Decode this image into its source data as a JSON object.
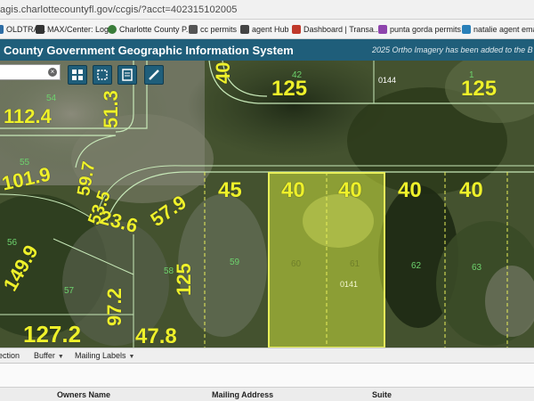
{
  "browser": {
    "url": "agis.charlottecountyfl.gov/ccgis/?acct=402315102005",
    "bookmarks": [
      {
        "label": "OLDTRAIL",
        "icon": "folder-icon",
        "color": "#2e6da4"
      },
      {
        "label": "MAX/Center: Login",
        "icon": "max-icon",
        "color": "#333333"
      },
      {
        "label": "Charlotte County P...",
        "icon": "county-seal-icon",
        "color": "#3a7d3a"
      },
      {
        "label": "cc permits",
        "icon": "document-icon",
        "color": "#555555"
      },
      {
        "label": "agent Hub",
        "icon": "hub-icon",
        "color": "#444444"
      },
      {
        "label": "Dashboard | Transa...",
        "icon": "dashboard-icon",
        "color": "#c0392b"
      },
      {
        "label": "punta gorda permits",
        "icon": "city-icon",
        "color": "#8e44ad"
      },
      {
        "label": "natalie agent email",
        "icon": "email-icon",
        "color": "#2980b9"
      }
    ]
  },
  "app": {
    "title": "County Government Geographic Information System",
    "banner": "2025 Ortho Imagery has been added to the B",
    "header_color": "#1f5e7a"
  },
  "map": {
    "tools": [
      {
        "name": "grid-icon"
      },
      {
        "name": "select-box-icon"
      },
      {
        "name": "layers-icon"
      },
      {
        "name": "measure-icon"
      }
    ],
    "dimension_labels": [
      {
        "id": "dim-125-top-left",
        "text": "125"
      },
      {
        "id": "dim-40-top",
        "text": "40"
      },
      {
        "id": "dim-125-top-right",
        "text": "125"
      },
      {
        "id": "dim-112-4",
        "text": "112.4"
      },
      {
        "id": "dim-51-3",
        "text": "51.3"
      },
      {
        "id": "dim-101-9",
        "text": "101.9"
      },
      {
        "id": "dim-59-7",
        "text": "59.7"
      },
      {
        "id": "dim-53-5",
        "text": "53.5"
      },
      {
        "id": "dim-23-6",
        "text": "23.6"
      },
      {
        "id": "dim-57-9",
        "text": "57.9"
      },
      {
        "id": "dim-45",
        "text": "45"
      },
      {
        "id": "dim-40-a",
        "text": "40"
      },
      {
        "id": "dim-40-b",
        "text": "40"
      },
      {
        "id": "dim-40-c",
        "text": "40"
      },
      {
        "id": "dim-40-d",
        "text": "40"
      },
      {
        "id": "dim-149-9",
        "text": "149.9"
      },
      {
        "id": "dim-125-mid",
        "text": "125"
      },
      {
        "id": "dim-97-2",
        "text": "97.2"
      },
      {
        "id": "dim-127-2",
        "text": "127.2"
      },
      {
        "id": "dim-47-8",
        "text": "47.8"
      }
    ],
    "lot_numbers": [
      "42",
      "1",
      "54",
      "55",
      "56",
      "57",
      "58",
      "59",
      "60",
      "61",
      "62",
      "63"
    ],
    "parcel_ids": [
      "0144",
      "0141"
    ]
  },
  "toolbar": {
    "items": [
      {
        "label": "ection",
        "has_caret": false
      },
      {
        "label": "Buffer",
        "has_caret": true
      },
      {
        "label": "Mailing Labels",
        "has_caret": true
      }
    ]
  },
  "results": {
    "columns": [
      "Owners Name",
      "Mailing Address",
      "Suite"
    ]
  }
}
